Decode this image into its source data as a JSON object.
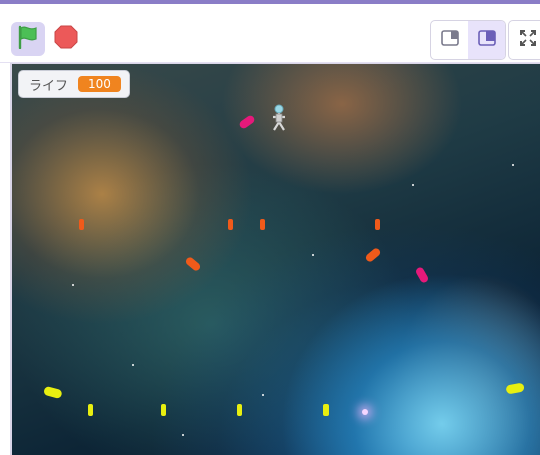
{
  "toolbar": {
    "flag_icon": "green-flag-icon",
    "stop_icon": "stop-icon",
    "view_small_icon": "small-stage-icon",
    "view_normal_icon": "normal-stage-icon",
    "fullscreen_icon": "fullscreen-icon"
  },
  "hud": {
    "label": "ライフ",
    "value": "100"
  },
  "colors": {
    "accent": "#8a7dc7",
    "flag": "#4cbf56",
    "stop": "#ec5959",
    "hud_badge": "#f0841f",
    "enemy_pink": "#e6197a",
    "enemy_orange": "#f05a1a",
    "enemy_yellow": "#e8ef10"
  }
}
